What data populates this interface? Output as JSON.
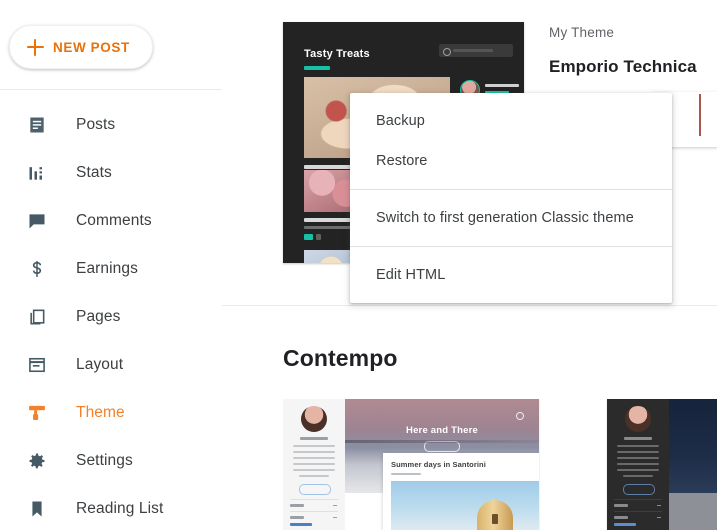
{
  "sidebar": {
    "new_post_label": "NEW POST",
    "new_post_icon": "plus-icon",
    "accent_color": "#e8710a",
    "active_color": "#f4812a",
    "items": [
      {
        "label": "Posts",
        "icon": "posts-icon",
        "active": false
      },
      {
        "label": "Stats",
        "icon": "stats-icon",
        "active": false
      },
      {
        "label": "Comments",
        "icon": "comments-icon",
        "active": false
      },
      {
        "label": "Earnings",
        "icon": "earnings-icon",
        "active": false
      },
      {
        "label": "Pages",
        "icon": "pages-icon",
        "active": false
      },
      {
        "label": "Layout",
        "icon": "layout-icon",
        "active": false
      },
      {
        "label": "Theme",
        "icon": "theme-brush-icon",
        "active": true
      },
      {
        "label": "Settings",
        "icon": "gear-icon",
        "active": false
      },
      {
        "label": "Reading List",
        "icon": "bookmark-icon",
        "active": false
      }
    ]
  },
  "main": {
    "my_theme_label": "My Theme",
    "theme_name": "Emporio Technica",
    "section_title": "Contempo",
    "preview": {
      "blog_title": "Tasty Treats",
      "search_icon": "search-icon",
      "background_color": "#232323",
      "accent_color": "#17c1a6"
    }
  },
  "menu": {
    "groups": [
      {
        "items": [
          {
            "label": "Backup"
          },
          {
            "label": "Restore"
          }
        ]
      },
      {
        "items": [
          {
            "label": "Switch to first generation Classic theme"
          }
        ]
      },
      {
        "items": [
          {
            "label": "Edit HTML"
          }
        ]
      }
    ]
  }
}
